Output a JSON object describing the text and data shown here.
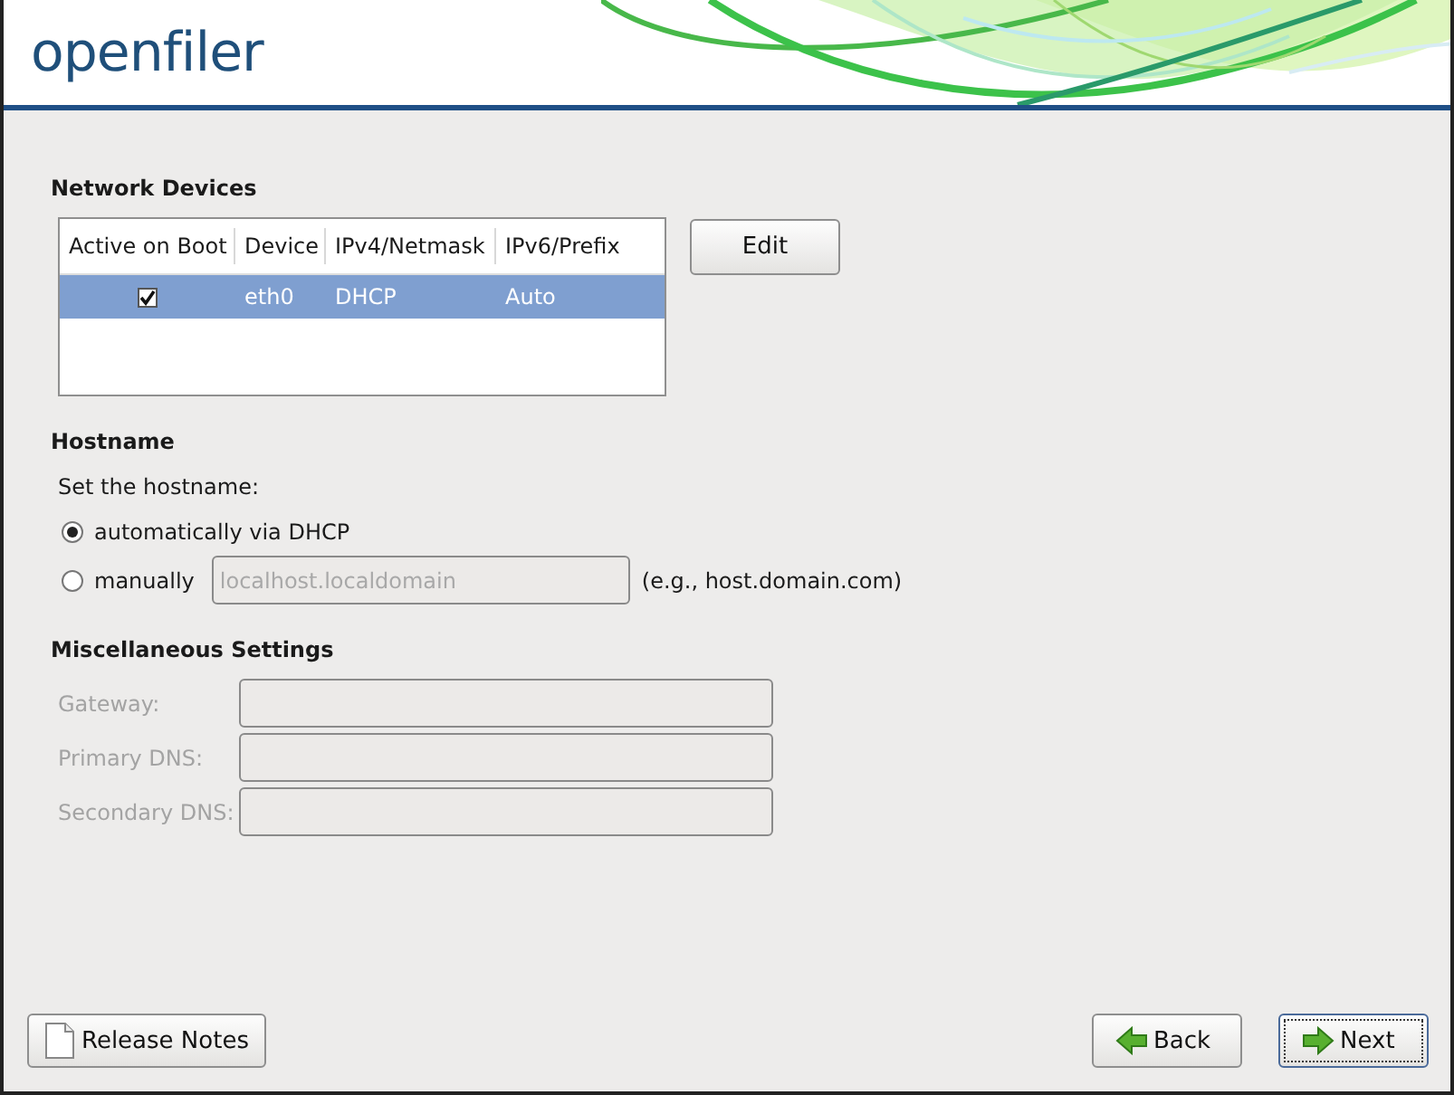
{
  "header": {
    "logo": "openfiler"
  },
  "network_devices": {
    "title": "Network Devices",
    "columns": [
      "Active on Boot",
      "Device",
      "IPv4/Netmask",
      "IPv6/Prefix"
    ],
    "rows": [
      {
        "active_on_boot": true,
        "device": "eth0",
        "ipv4": "DHCP",
        "ipv6": "Auto",
        "selected": true
      }
    ],
    "edit_button": "Edit"
  },
  "hostname": {
    "title": "Hostname",
    "prompt": "Set the hostname:",
    "options": [
      {
        "label": "automatically via DHCP",
        "selected": true
      },
      {
        "label": "manually",
        "selected": false
      }
    ],
    "field": {
      "value": "localhost.localdomain",
      "disabled": true
    },
    "hint": "(e.g., host.domain.com)"
  },
  "misc": {
    "title": "Miscellaneous Settings",
    "fields": [
      {
        "label": "Gateway:",
        "disabled": true
      },
      {
        "label": "Primary DNS:",
        "disabled": true
      },
      {
        "label": "Secondary DNS:",
        "disabled": true
      }
    ]
  },
  "footer": {
    "release_notes": "Release Notes",
    "back": "Back",
    "next": "Next"
  }
}
